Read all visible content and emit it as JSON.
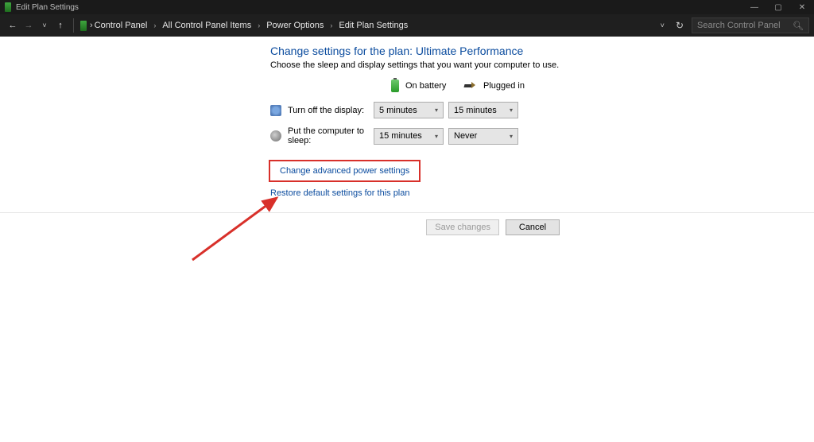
{
  "titlebar": {
    "title": "Edit Plan Settings"
  },
  "toolbar": {
    "breadcrumb": [
      "Control Panel",
      "All Control Panel Items",
      "Power Options",
      "Edit Plan Settings"
    ],
    "search_placeholder": "Search Control Panel"
  },
  "main": {
    "heading": "Change settings for the plan: Ultimate Performance",
    "subtitle": "Choose the sleep and display settings that you want your computer to use.",
    "columns": {
      "battery": "On battery",
      "plugged_in": "Plugged in"
    },
    "rows": [
      {
        "label": "Turn off the display:",
        "battery_value": "5 minutes",
        "plugged_value": "15 minutes"
      },
      {
        "label": "Put the computer to sleep:",
        "battery_value": "15 minutes",
        "plugged_value": "Never"
      }
    ],
    "link_advanced": "Change advanced power settings",
    "link_restore": "Restore default settings for this plan",
    "btn_save": "Save changes",
    "btn_cancel": "Cancel"
  }
}
